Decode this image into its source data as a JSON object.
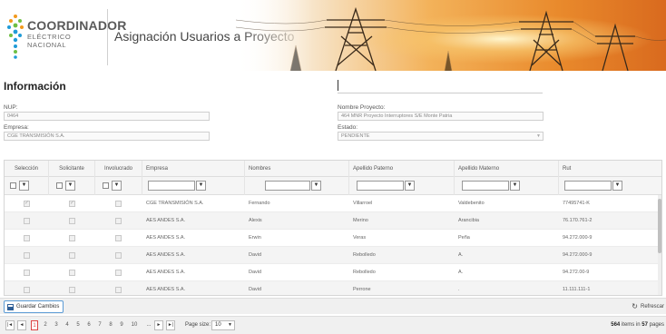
{
  "header": {
    "logo_main": "COORDINADOR",
    "logo_sub": "ELÉCTRICO NACIONAL",
    "title": "Asignación Usuarios a Proyecto"
  },
  "info": {
    "section_title": "Información",
    "nup_label": "NUP:",
    "nup_value": "0464",
    "empresa_label": "Empresa:",
    "empresa_value": "CGE TRANSMISIÓN S.A.",
    "proyecto_label": "Nombre Proyecto:",
    "proyecto_value": "464 MNR Proyecto Interruptores S/E Monte Patria",
    "estado_label": "Estado:",
    "estado_value": "PENDIENTE"
  },
  "grid": {
    "columns": [
      "Selección",
      "Solicitante",
      "Involucrado",
      "Empresa",
      "Nombres",
      "Apellido Paterno",
      "Apellido Materno",
      "Rut"
    ],
    "filter_icon": "filter-icon",
    "rows": [
      {
        "seleccion": true,
        "solicitante": true,
        "involucrado": false,
        "empresa": "CGE TRANSMISIÓN S.A.",
        "nombres": "Fernando",
        "paterno": "Villarroel",
        "materno": "Valdebenito",
        "rut": "77495741-K"
      },
      {
        "seleccion": false,
        "solicitante": false,
        "involucrado": false,
        "empresa": "AES ANDES S.A.",
        "nombres": "Alexis",
        "paterno": "Merino",
        "materno": "Arancibia",
        "rut": "76.170.761-2"
      },
      {
        "seleccion": false,
        "solicitante": false,
        "involucrado": false,
        "empresa": "AES ANDES S.A.",
        "nombres": "Erwin",
        "paterno": "Veras",
        "materno": "Peña",
        "rut": "94.272.000-9"
      },
      {
        "seleccion": false,
        "solicitante": false,
        "involucrado": false,
        "empresa": "AES ANDES S.A.",
        "nombres": "David",
        "paterno": "Rebolledo",
        "materno": "A.",
        "rut": "94.272.000-9"
      },
      {
        "seleccion": false,
        "solicitante": false,
        "involucrado": false,
        "empresa": "AES ANDES S.A.",
        "nombres": "David",
        "paterno": "Rebolledo",
        "materno": "A.",
        "rut": "94.272.00-9"
      },
      {
        "seleccion": false,
        "solicitante": false,
        "involucrado": false,
        "empresa": "AES ANDES S.A.",
        "nombres": "David",
        "paterno": "Perrone",
        "materno": ".",
        "rut": "11.111.111-1"
      }
    ]
  },
  "toolbar": {
    "save_label": "Guardar Cambios",
    "refresh_label": "Refrescar"
  },
  "pager": {
    "pages": [
      "1",
      "2",
      "3",
      "4",
      "5",
      "6",
      "7",
      "8",
      "9",
      "10",
      "..."
    ],
    "current_page": "1",
    "first": "|◄",
    "prev": "◄",
    "next": "►",
    "last": "►|",
    "page_size_label": "Page size:",
    "page_size": "10",
    "items_total": "564",
    "items_mid": "items in",
    "pages_total": "57",
    "pages_suffix": "pages"
  }
}
